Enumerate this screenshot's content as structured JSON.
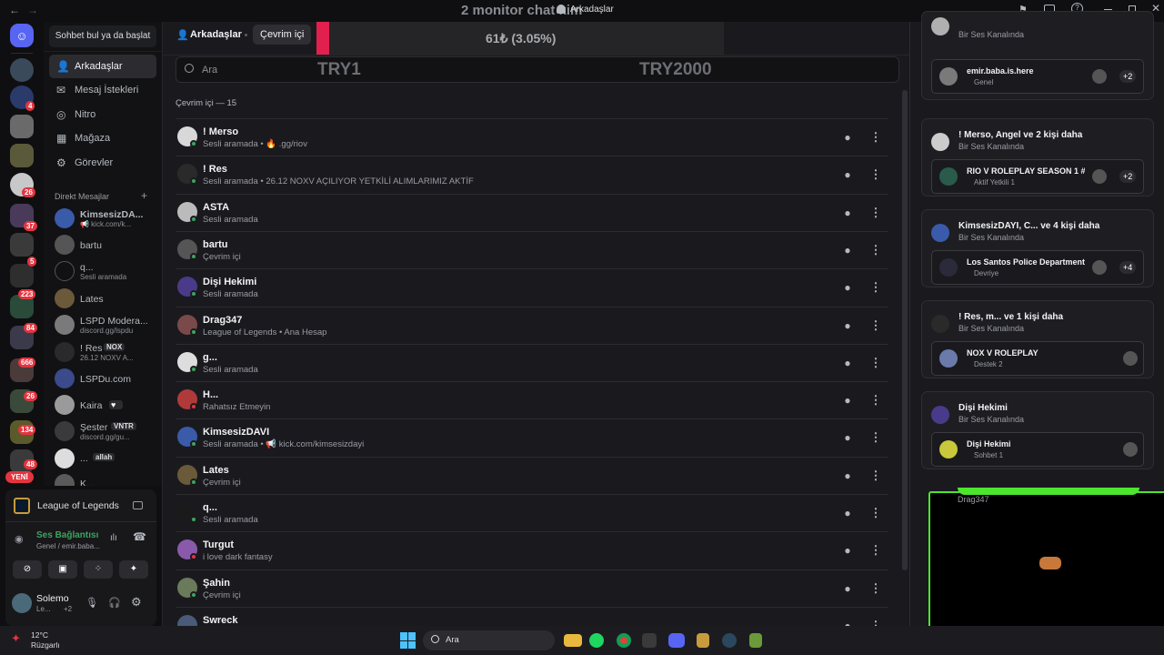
{
  "window": {
    "title": "Arkadaşlar",
    "overlay_title": "2 monitor chat kim"
  },
  "overlay": {
    "goal_text": "61₺ (3.05%)",
    "goal_min": "TRY1",
    "goal_max": "TRY2000",
    "progress": 0.0305
  },
  "sidebar": {
    "search_label": "Sohbet bul ya da başlat",
    "nav": [
      "Arkadaşlar",
      "Mesaj İstekleri",
      "Nitro",
      "Mağaza",
      "Görevler"
    ],
    "dm_header": "Direkt Mesajlar",
    "dms": [
      {
        "name": "KimsesizDA...",
        "sub": "📢 kick.com/k..."
      },
      {
        "name": "bartu",
        "sub": ""
      },
      {
        "name": "q...",
        "sub": "Sesli aramada"
      },
      {
        "name": "Lates",
        "sub": ""
      },
      {
        "name": "LSPD Modera...",
        "sub": "discord.gg/lspdu"
      },
      {
        "name": "! Res",
        "tag": "NOX",
        "sub": "26.12 NOXV A..."
      },
      {
        "name": "LSPDu.com",
        "sub": ""
      },
      {
        "name": "Kaira",
        "sub": ""
      },
      {
        "name": "Şester",
        "tag": "VNTR",
        "sub": "discord.gg/gu..."
      },
      {
        "name": "...",
        "tag": "allah",
        "sub": ""
      },
      {
        "name": "K...",
        "sub": ""
      }
    ],
    "game": "League of Legends",
    "voice": {
      "status": "Ses Bağlantısı Kuruldu",
      "channel": "Genel / emir.baba..."
    },
    "user": {
      "name": "Solemo",
      "sub": "Le...",
      "count": "+2"
    }
  },
  "servers": {
    "badges": [
      "4",
      "26",
      "37",
      "5",
      "223",
      "84",
      "666",
      "26",
      "134",
      "48"
    ],
    "new_label": "YENİ"
  },
  "header": {
    "title": "Arkadaşlar",
    "tab_online": "Çevrim içi"
  },
  "search": {
    "placeholder": "Ara"
  },
  "friends": {
    "section": "Çevrim içi — 15",
    "items": [
      {
        "name": "! Merso",
        "status": "Sesli aramada • 🔥 .gg/riov",
        "color": "#3ba55d",
        "av": "#d8d8d8"
      },
      {
        "name": "! Res",
        "status": "Sesli aramada • 26.12 NOXV AÇILIYOR YETKİLİ ALIMLARIMIZ AKTİF",
        "color": "#3ba55d",
        "av": "#2a2a2a"
      },
      {
        "name": "ASTA",
        "status": "Sesli aramada",
        "color": "#3ba55d",
        "av": "#bbbbbb"
      },
      {
        "name": "bartu",
        "status": "Çevrim içi",
        "color": "#3ba55d",
        "av": "#555555"
      },
      {
        "name": "Dişi Hekimi",
        "status": "Sesli aramada",
        "color": "#3ba55d",
        "av": "#4a3a8a"
      },
      {
        "name": "Drag347",
        "status": "League of Legends • Ana Hesap",
        "color": "#3ba55d",
        "av": "#7a4a4a"
      },
      {
        "name": "g...",
        "status": "Sesli aramada",
        "color": "#3ba55d",
        "av": "#dddddd"
      },
      {
        "name": "H...",
        "status": "Rahatsız Etmeyin",
        "color": "#e3343f",
        "av": "#b03a3a"
      },
      {
        "name": "KimsesizDAVI",
        "status": "Sesli aramada • 📢 kick.com/kimsesizdayi",
        "color": "#3ba55d",
        "av": "#3a5aaa"
      },
      {
        "name": "Lates",
        "status": "Çevrim içi",
        "color": "#3ba55d",
        "av": "#6a5a3a"
      },
      {
        "name": "q...",
        "status": "Sesli aramada",
        "color": "#3ba55d",
        "av": "#1a1a1a"
      },
      {
        "name": "Turgut",
        "status": "i love dark fantasy",
        "color": "#e3343f",
        "av": "#8a5aaa"
      },
      {
        "name": "Şahin",
        "status": "Çevrim içi",
        "color": "#3ba55d",
        "av": "#6a7a5a"
      },
      {
        "name": "Swreck",
        "status": "",
        "color": "#3ba55d",
        "av": "#4a5a7a"
      }
    ]
  },
  "activity": {
    "cards": [
      {
        "title": "",
        "sub": "Bir Ses Kanalında",
        "inner_title": "emir.baba.is.here",
        "inner_sub": "Genel",
        "count": "+2"
      },
      {
        "title": "! Merso, Angel ve 2 kişi daha",
        "sub": "Bir Ses Kanalında",
        "inner_title": "RIO V ROLEPLAY SEASON 1 #...",
        "inner_sub": "Aktif Yetkili 1",
        "count": "+2"
      },
      {
        "title": "KimsesizDAYI, C... ve 4 kişi daha",
        "sub": "Bir Ses Kanalında",
        "inner_title": "Los Santos Police Department",
        "inner_sub": "Devriye",
        "count": "+4"
      },
      {
        "title": "! Res, m... ve 1 kişi daha",
        "sub": "Bir Ses Kanalında",
        "inner_title": "NOX V ROLEPLAY",
        "inner_sub": "Destek 2",
        "count": ""
      },
      {
        "title": "Dişi Hekimi",
        "sub": "Bir Ses Kanalında",
        "inner_title": "Dişi Hekimi",
        "inner_sub": "Sohbet 1",
        "count": ""
      }
    ],
    "partial_name": "Drag347"
  },
  "taskbar": {
    "weather_temp": "12°C",
    "weather_label": "Rüzgarlı",
    "search": "Ara"
  },
  "colors": {
    "online": "#3ba55d",
    "dnd": "#e3343f",
    "accent": "#5865f2",
    "stream_border": "#4be62d"
  }
}
